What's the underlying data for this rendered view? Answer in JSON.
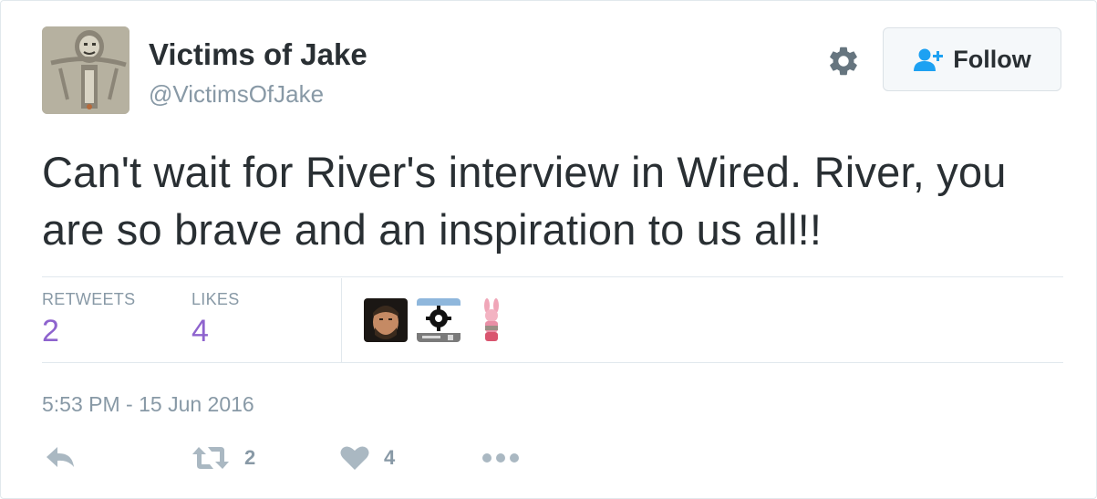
{
  "user": {
    "display_name": "Victims of Jake",
    "handle": "@VictimsOfJake"
  },
  "follow_button": {
    "label": "Follow",
    "icon": "add-user-icon"
  },
  "settings_icon": "gear-icon",
  "tweet": {
    "text": "Can't wait for River's interview in Wired. River, you are so brave and an inspiration to us all!!"
  },
  "stats": {
    "retweets_label": "RETWEETS",
    "retweets_value": "2",
    "likes_label": "LIKES",
    "likes_value": "4"
  },
  "timestamp": "5:53 PM - 15 Jun 2016",
  "actions": {
    "reply_icon": "reply-icon",
    "retweet_icon": "retweet-icon",
    "retweet_count": "2",
    "like_icon": "heart-icon",
    "like_count": "4",
    "more_icon": "more-dots-icon"
  },
  "colors": {
    "text": "#292f33",
    "muted": "#8899a6",
    "stat_value": "#8e63ce",
    "action_icon": "#aab8c2",
    "follow_icon": "#1da1f2"
  }
}
